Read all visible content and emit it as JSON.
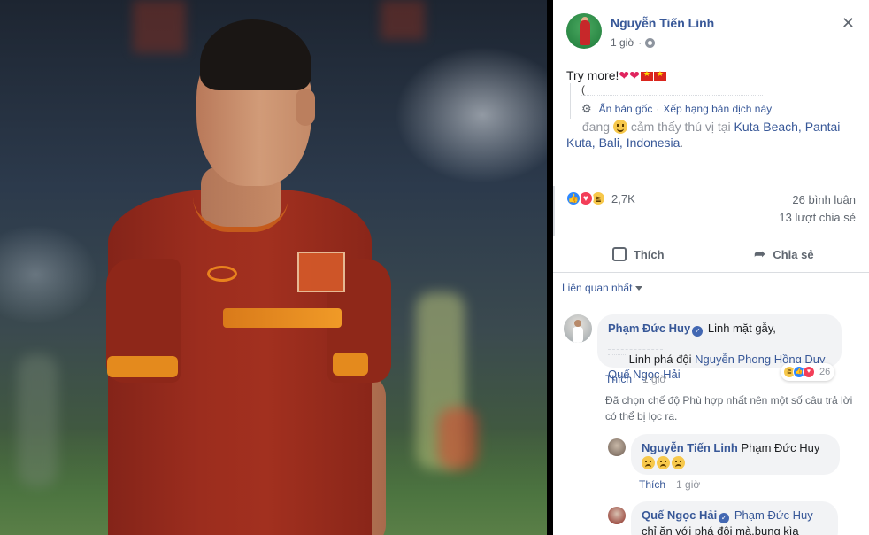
{
  "post": {
    "author": "Nguyễn Tiến Linh",
    "time": "1 giờ",
    "text": "Try more!",
    "translation": {
      "lead": "(",
      "show_original": "Ẩn bản gốc",
      "separator": "·",
      "rate": "Xếp hạng bản dịch này"
    },
    "feeling_prefix": "— đang",
    "feeling_text": "cảm thấy thú vị tại",
    "location": "Kuta Beach, Pantai Kuta, Bali, Indonesia",
    "location_suffix": "."
  },
  "stats": {
    "reactions": "2,7K",
    "comments": "26 bình luận",
    "shares": "13 lượt chia sẻ"
  },
  "actions": {
    "like": "Thích",
    "share": "Chia sẻ"
  },
  "sort": {
    "label": "Liên quan nhất"
  },
  "comments": [
    {
      "author": "Phạm Đức Huy",
      "text_1": "Linh mặt gẫy,",
      "text_2": "Linh phá đội",
      "mention_1": "Nguyễn Phong Hồng Duy",
      "mention_2": "Quế Ngọc Hải",
      "reaction_count": "26",
      "like": "Thích",
      "time": "1 giờ"
    },
    {
      "author": "Nguyễn Tiến Linh",
      "mention": "Phạm Đức Huy",
      "like": "Thích",
      "time": "1 giờ"
    },
    {
      "author": "Quế Ngọc Hải",
      "mention": "Phạm Đức Huy",
      "text": "chỉ ăn với phá đội mà.bụng kìa"
    }
  ],
  "filter_note": "Đã chọn chế độ Phù hợp nhất nên một số câu trả lời có thể bị lọc ra.",
  "icons": {
    "close": "close-icon",
    "globe": "globe-icon",
    "gear": "gear-icon",
    "like": "thumbs-up-icon",
    "share": "share-arrow-icon"
  },
  "colors": {
    "link": "#385898",
    "muted": "#606770",
    "bubble": "#f2f3f5",
    "like_blue": "#2d88ff",
    "love_red": "#f33e58",
    "haha_yellow": "#f7c84b"
  }
}
